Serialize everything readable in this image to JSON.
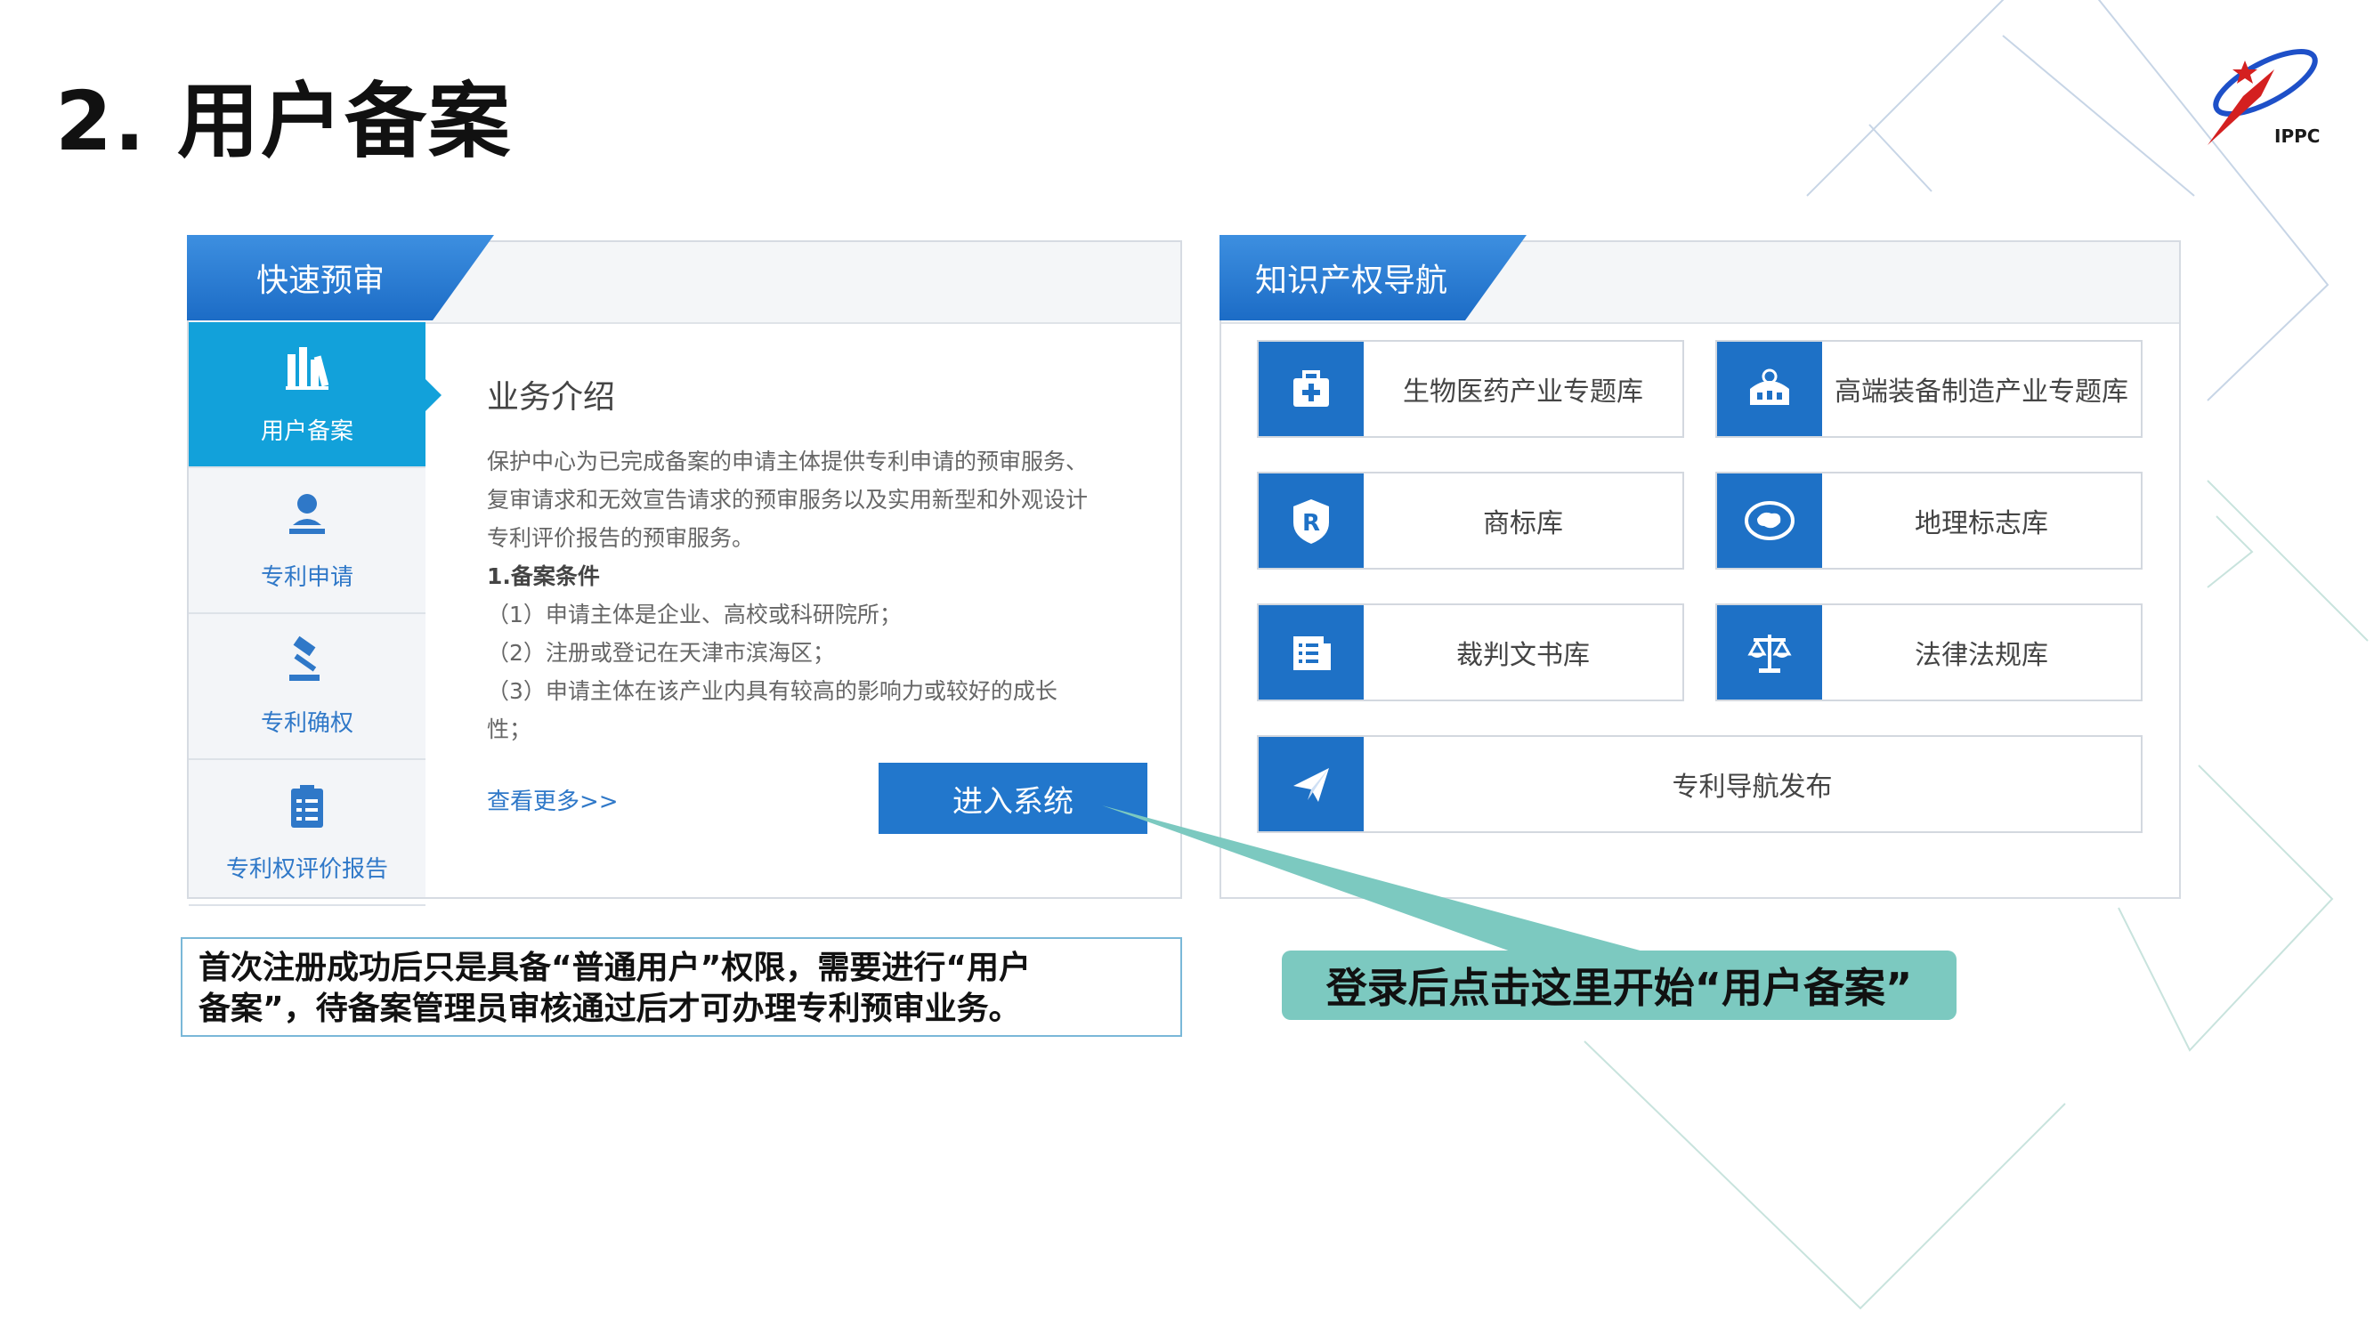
{
  "slide": {
    "title": "2. 用户备案",
    "logo_text": "IPPC"
  },
  "left_panel": {
    "tab_label": "快速预审",
    "side_nav": [
      {
        "label": "用户备案",
        "icon": "books-icon",
        "active": true
      },
      {
        "label": "专利申请",
        "icon": "user-stamp-icon",
        "active": false
      },
      {
        "label": "专利确权",
        "icon": "gavel-icon",
        "active": false
      },
      {
        "label": "专利权评价报告",
        "icon": "clipboard-icon",
        "active": false
      }
    ],
    "intro": {
      "title": "业务介绍",
      "lines": [
        "保护中心为已完成备案的申请主体提供专利申请的预审服务、",
        "复审请求和无效宣告请求的预审服务以及实用新型和外观设计",
        "专利评价报告的预审服务。"
      ],
      "conditions_title": "1.备案条件",
      "conditions": [
        "（1）申请主体是企业、高校或科研院所；",
        "（2）注册或登记在天津市滨海区；",
        "（3）申请主体在该产业内具有较高的影响力或较好的成长",
        "性；"
      ]
    },
    "more_link": "查看更多>>",
    "enter_button": "进入系统"
  },
  "right_panel": {
    "tab_label": "知识产权导航",
    "cards": [
      {
        "label": "生物医药产业专题库",
        "icon": "medical-kit-icon"
      },
      {
        "label": "高端装备制造产业专题库",
        "icon": "equipment-icon"
      },
      {
        "label": "商标库",
        "icon": "shield-r-icon"
      },
      {
        "label": "地理标志库",
        "icon": "globe-map-icon"
      },
      {
        "label": "裁判文书库",
        "icon": "document-icon"
      },
      {
        "label": "法律法规库",
        "icon": "scales-icon"
      },
      {
        "label": "专利导航发布",
        "icon": "paper-plane-icon"
      }
    ]
  },
  "note": {
    "line1": "首次注册成功后只是具备“普通用户”权限，需要进行“用户",
    "line2": "备案”，待备案管理员审核通过后才可办理专利预审业务。"
  },
  "callout": {
    "text": "登录后点击这里开始“用户备案”"
  },
  "colors": {
    "primary_blue": "#1e71c6",
    "active_cyan": "#12a1da",
    "callout_teal": "#7cc9c0"
  }
}
